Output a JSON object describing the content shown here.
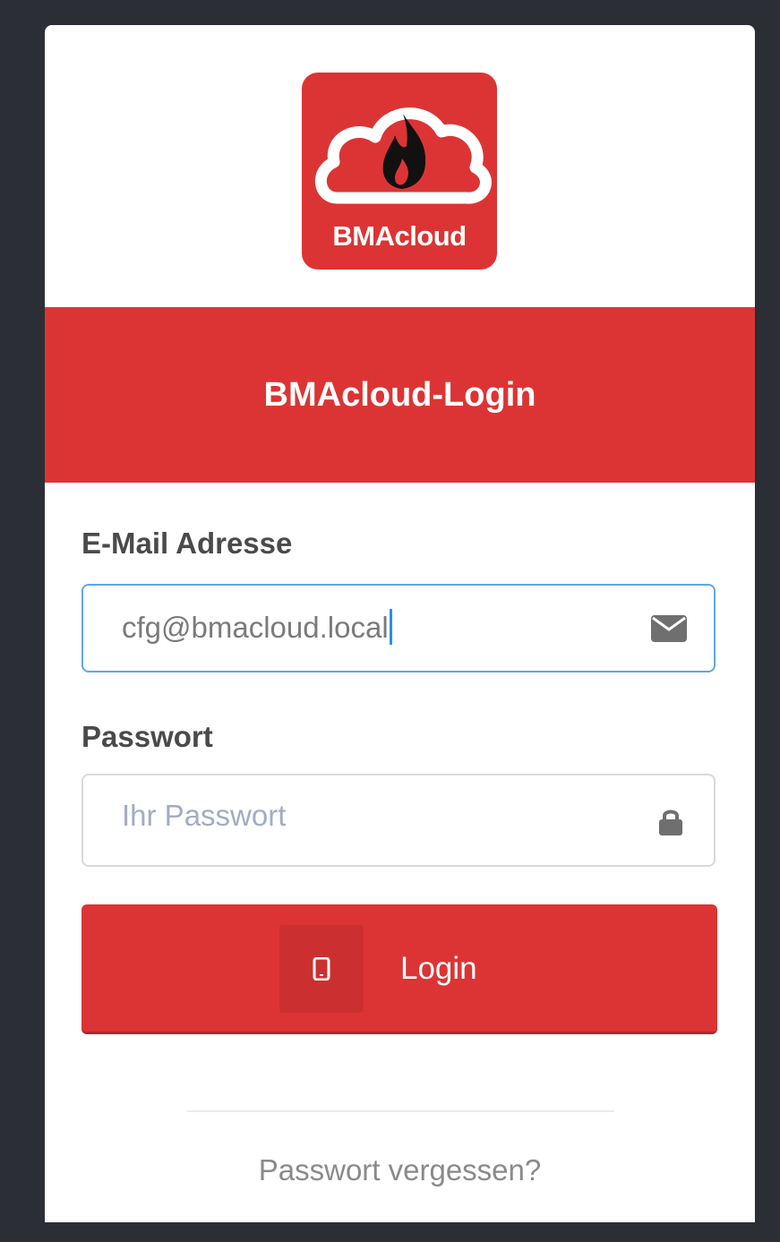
{
  "logo": {
    "text": "BMAcloud",
    "icon": "cloud-fire-icon"
  },
  "banner": {
    "title": "BMAcloud-Login"
  },
  "email": {
    "label": "E-Mail Adresse",
    "value": "cfg@bmacloud.local",
    "icon": "envelope-icon",
    "focused": true
  },
  "password": {
    "label": "Passwort",
    "placeholder": "Ihr Passwort",
    "icon": "lock-icon"
  },
  "login_button": {
    "label": "Login",
    "icon": "mobile-phone-icon"
  },
  "forgot_link": {
    "label": "Passwort vergessen?"
  },
  "colors": {
    "brand": "#dc3434",
    "background": "#2b2e34",
    "focus": "#5fa8e8"
  }
}
